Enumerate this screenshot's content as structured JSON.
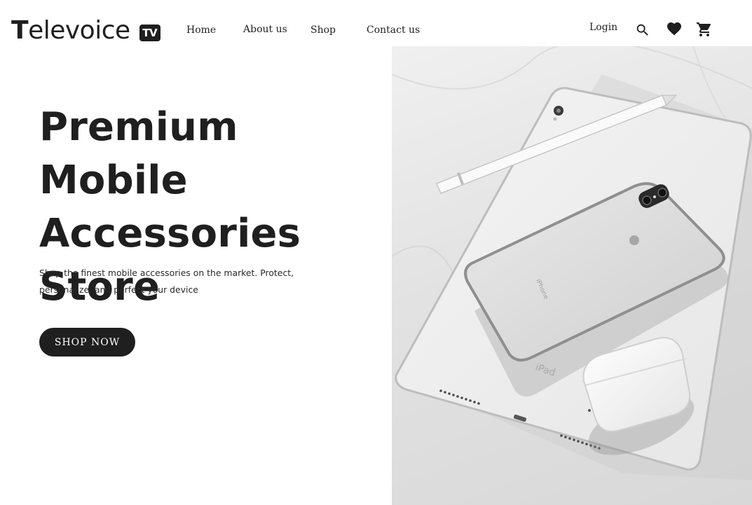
{
  "brand": {
    "name_first": "T",
    "name_rest": "elevoice",
    "badge": "TV"
  },
  "nav": {
    "home": "Home",
    "about": "About us",
    "shop": "Shop",
    "contact": "Contact us"
  },
  "header": {
    "login": "Login",
    "icons": [
      "search-icon",
      "heart-icon",
      "cart-icon"
    ]
  },
  "hero": {
    "title": "Premium Mobile Accessories Store",
    "subtitle": "Shop the finest mobile accessories on the market. Protect, personalize, and perfect your device",
    "cta": "SHOP NOW"
  },
  "image": {
    "phone_text": "iPhone",
    "tablet_text": "iPad"
  },
  "colors": {
    "text": "#1f1f1f",
    "background": "#ffffff",
    "button": "#1f1f1f"
  }
}
